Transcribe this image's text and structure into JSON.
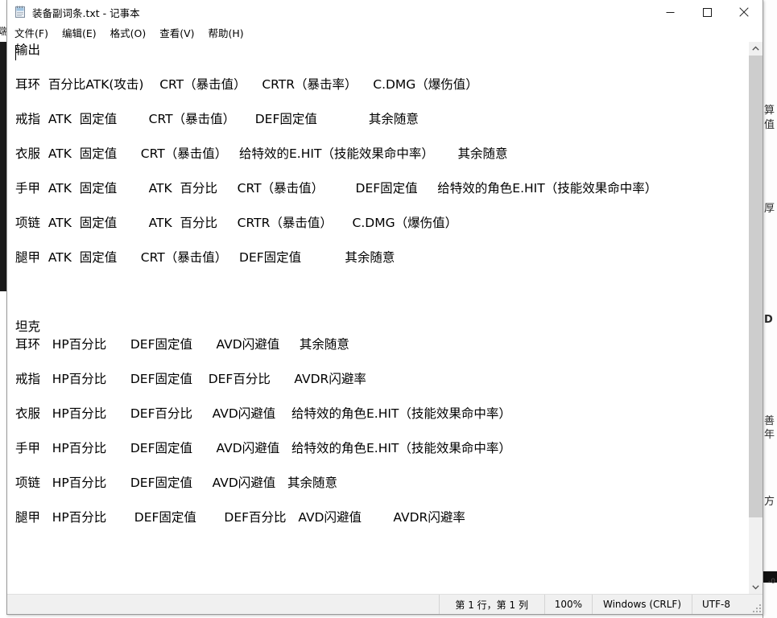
{
  "window": {
    "title": "装备副词条.txt - 记事本",
    "icon": "notepad-icon",
    "minimize_label": "最小化",
    "maximize_label": "最大化",
    "close_label": "关闭"
  },
  "menu": {
    "items": [
      {
        "label": "文件(F)",
        "name": "menu-file"
      },
      {
        "label": "编辑(E)",
        "name": "menu-edit"
      },
      {
        "label": "格式(O)",
        "name": "menu-format"
      },
      {
        "label": "查看(V)",
        "name": "menu-view"
      },
      {
        "label": "帮助(H)",
        "name": "menu-help"
      }
    ]
  },
  "document": {
    "lines": [
      "输出",
      "",
      "耳环  百分比ATK(攻击)    CRT（暴击值）    CRTR（暴击率）    C.DMG（爆伤值）",
      "",
      "戒指  ATK  固定值        CRT（暴击值）     DEF固定值             其余随意",
      "",
      "衣服  ATK  固定值      CRT（暴击值）   给特效的E.HIT（技能效果命中率）      其余随意",
      "",
      "手甲  ATK  固定值        ATK  百分比     CRT（暴击值）        DEF固定值     给特效的角色E.HIT（技能效果命中率）",
      "",
      "项链  ATK  固定值        ATK  百分比     CRTR（暴击值）     C.DMG（爆伤值）",
      "",
      "腿甲  ATK  固定值      CRT（暴击值）   DEF固定值           其余随意",
      "",
      "",
      "",
      "坦克",
      "耳环   HP百分比      DEF固定值      AVD闪避值     其余随意",
      "",
      "戒指   HP百分比      DEF固定值    DEF百分比      AVDR闪避率",
      "",
      "衣服   HP百分比      DEF百分比     AVD闪避值    给特效的角色E.HIT（技能效果命中率）",
      "",
      "手甲   HP百分比      DEF固定值      AVD闪避值   给特效的角色E.HIT（技能效果命中率）",
      "",
      "项链   HP百分比      DEF固定值     AVD闪避值   其余随意",
      "",
      "腿甲   HP百分比       DEF固定值       DEF百分比   AVD闪避值        AVDR闪避率"
    ]
  },
  "status": {
    "cursor": "第 1 行，第 1 列",
    "zoom": "100%",
    "line_ending": "Windows (CRLF)",
    "encoding": "UTF-8"
  },
  "scrollbar": {
    "up_label": "向上滚动",
    "down_label": "向下滚动"
  },
  "backdrop": {
    "left_glyph": "端",
    "right_glyphs": [
      "算",
      "值",
      "厚",
      "D",
      "善",
      "年",
      "方"
    ]
  },
  "colors": {
    "window_bg": "#ffffff",
    "text": "#000000",
    "status_bg": "#f0f0f0",
    "scrollbar_thumb": "#cdcdcd",
    "border": "#9a9a9a"
  }
}
